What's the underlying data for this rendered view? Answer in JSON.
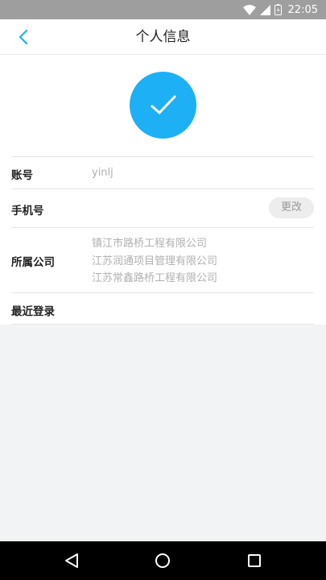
{
  "status_bar": {
    "time": "22:05"
  },
  "header": {
    "title": "个人信息"
  },
  "avatar": {
    "icon": "checkmark-icon",
    "color": "#1db0f5"
  },
  "account": {
    "label": "账号",
    "value": "yinlj"
  },
  "phone": {
    "label": "手机号",
    "value": "",
    "change_label": "更改"
  },
  "company": {
    "label": "所属公司",
    "items": [
      "镇江市路桥工程有限公司",
      "江苏润通项目管理有限公司",
      "江苏常鑫路桥工程有限公司"
    ]
  },
  "last_login": {
    "label": "最近登录",
    "value": ""
  },
  "nav": {
    "back": "back-triangle-icon",
    "home": "home-circle-icon",
    "recents": "recents-square-icon"
  }
}
